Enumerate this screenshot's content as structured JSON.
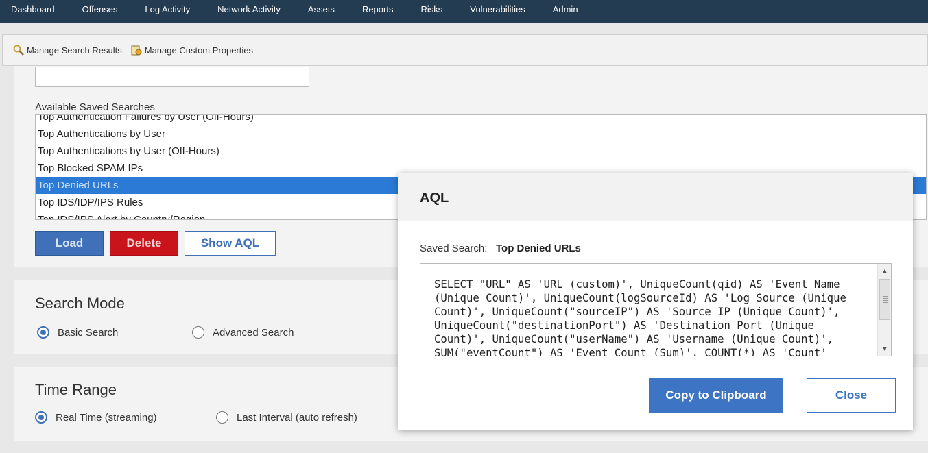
{
  "nav": {
    "items": [
      "Dashboard",
      "Offenses",
      "Log Activity",
      "Network Activity",
      "Assets",
      "Reports",
      "Risks",
      "Vulnerabilities",
      "Admin"
    ]
  },
  "toolbar": {
    "manage_results": "Manage Search Results",
    "manage_properties": "Manage Custom Properties"
  },
  "saved_searches": {
    "label": "Available Saved Searches",
    "items": [
      "Top Authentication Failures by User (Off-Hours)",
      "Top Authentications by User",
      "Top Authentications by User (Off-Hours)",
      "Top Blocked SPAM IPs",
      "Top Denied URLs",
      "Top IDS/IDP/IPS Rules",
      "Top IDS/IPS Alert by Country/Region"
    ],
    "selected": "Top Denied URLs",
    "load_label": "Load",
    "delete_label": "Delete",
    "show_aql_label": "Show AQL"
  },
  "search_mode": {
    "title": "Search Mode",
    "basic": "Basic Search",
    "advanced": "Advanced Search",
    "selected": "Basic Search"
  },
  "time_range": {
    "title": "Time Range",
    "real_time": "Real Time (streaming)",
    "last_interval": "Last Interval (auto refresh)",
    "selected": "Real Time (streaming)"
  },
  "modal": {
    "title": "AQL",
    "saved_search_label": "Saved Search:",
    "saved_search_value": "Top Denied URLs",
    "aql": "SELECT \"URL\" AS 'URL (custom)', UniqueCount(qid) AS 'Event Name (Unique Count)', UniqueCount(logSourceId) AS 'Log Source (Unique Count)', UniqueCount(\"sourceIP\") AS 'Source IP (Unique Count)', UniqueCount(\"destinationPort\") AS 'Destination Port (Unique Count)', UniqueCount(\"userName\") AS 'Username (Unique Count)', SUM(\"eventCount\") AS 'Event Count (Sum)', COUNT(*) AS 'Count'",
    "copy_label": "Copy to Clipboard",
    "close_label": "Close"
  },
  "colors": {
    "nav_bg": "#243c52",
    "primary": "#3f70b8",
    "danger": "#c9141b",
    "selected_row": "#2b7bd6"
  }
}
